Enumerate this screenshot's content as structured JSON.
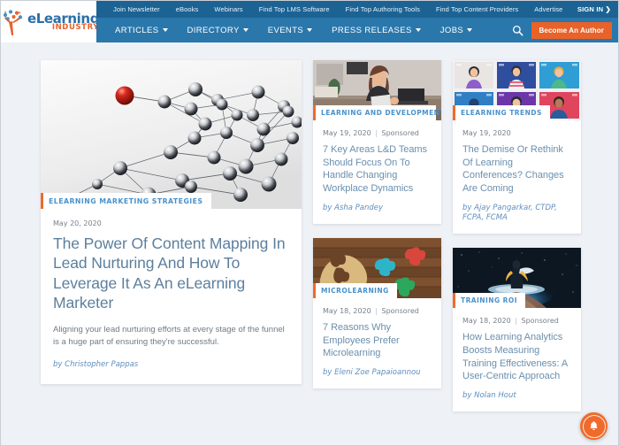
{
  "site": {
    "logo_primary": "eLearning",
    "logo_secondary": "INDUSTRY",
    "brand_blue": "#2a77ab",
    "brand_dark_blue": "#1c6394",
    "brand_orange": "#e8622a",
    "page_bg": "#eef1f5"
  },
  "topbar": {
    "links": [
      "Join Newsletter",
      "eBooks",
      "Webinars",
      "Find Top LMS Software",
      "Find Top Authoring Tools",
      "Find Top Content Providers",
      "Advertise"
    ],
    "sign_in": "SIGN IN ❯"
  },
  "nav": {
    "items": [
      {
        "label": "ARTICLES",
        "has_caret": true
      },
      {
        "label": "DIRECTORY",
        "has_caret": true
      },
      {
        "label": "EVENTS",
        "has_caret": true
      },
      {
        "label": "PRESS RELEASES",
        "has_caret": true
      },
      {
        "label": "JOBS",
        "has_caret": true
      }
    ],
    "search_icon": "search-icon",
    "cta_label": "Become An Author"
  },
  "featured": {
    "category": "ELEARNING MARKETING STRATEGIES",
    "date": "May 20, 2020",
    "title": "The Power Of Content Mapping In Lead Nurturing And How To Leverage It As An eLearning Marketer",
    "excerpt": "Aligning your lead nurturing efforts at every stage of the funnel is a huge part of ensuring they're successful.",
    "byline": "by Christopher Pappas",
    "image_alt": "network-of-spheres-image"
  },
  "articles": [
    {
      "category": "LEARNING AND DEVELOPMENT",
      "date": "May 19, 2020",
      "separator": "|",
      "sponsored": "Sponsored",
      "title": "7 Key Areas L&D Teams Should Focus On To Handle Changing Workplace Dynamics",
      "byline": "by Asha Pandey",
      "image_alt": "woman-at-desk-photo"
    },
    {
      "category": "ELEARNING TRENDS",
      "date": "May 19, 2020",
      "separator": "",
      "sponsored": "",
      "title": "The Demise Or Rethink Of Learning Conferences? Changes Are Coming",
      "byline": "by Ajay Pangarkar, CTDP, FCPA, FCMA",
      "image_alt": "video-conference-grid-illustration"
    },
    {
      "category": "MICROLEARNING",
      "date": "May 18, 2020",
      "separator": "|",
      "sponsored": "Sponsored",
      "title": "7 Reasons Why Employees Prefer Microlearning",
      "byline": "by Eleni Zoe Papaioannou",
      "image_alt": "head-puzzle-pieces-photo"
    },
    {
      "category": "TRAINING ROI",
      "date": "May 18, 2020",
      "separator": "|",
      "sponsored": "Sponsored",
      "title": "How Learning Analytics Boosts Measuring Training Effectiveness: A User-Centric Approach",
      "byline": "by Nolan Hout",
      "image_alt": "figure-on-glowing-platform-photo"
    }
  ],
  "fab": {
    "icon": "bell-icon"
  }
}
